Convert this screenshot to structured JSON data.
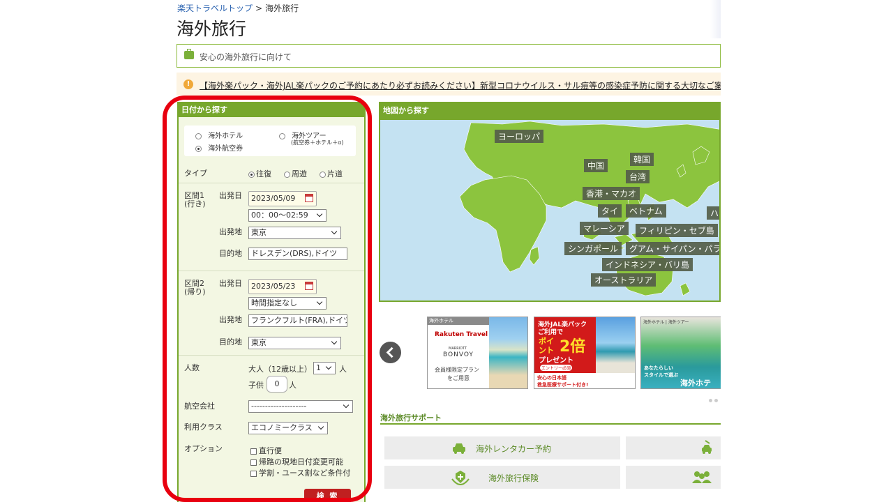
{
  "breadcrumb": {
    "home": "楽天トラベルトップ",
    "sep": ">",
    "current": "海外旅行"
  },
  "page_title": "海外旅行",
  "safety_banner": "安心の海外旅行に向けて",
  "notice": "【海外楽パック・海外JAL楽パックのご予約にあたり必ずお読みください】新型コロナウイルス・サル痘等の感染症予防に関する大切なご案内",
  "date_search": {
    "header": "日付から探す",
    "product_types": {
      "hotel": "海外ホテル",
      "tour": "海外ツアー",
      "tour_sub": "(航空券＋ホテル＋α)",
      "air": "海外航空券",
      "selected": "海外航空券"
    },
    "trip_type": {
      "label": "タイプ",
      "options": [
        "往復",
        "周遊",
        "片道"
      ],
      "selected": "往復"
    },
    "leg1": {
      "label_line1": "区間1",
      "label_line2": "(行き)",
      "date_label": "出発日",
      "date": "2023/05/09",
      "time": "00：00～02:59",
      "from_label": "出発地",
      "from": "東京",
      "to_label": "目的地",
      "to": "ドレスデン(DRS),ドイツ"
    },
    "leg2": {
      "label_line1": "区間2",
      "label_line2": "(帰り)",
      "date_label": "出発日",
      "date": "2023/05/23",
      "time": "時間指定なし",
      "from_label": "出発地",
      "from": "フランクフルト(FRA),ドイツ",
      "to_label": "目的地",
      "to": "東京"
    },
    "travelers": {
      "label": "人数",
      "adult_label": "大人（12歳以上）",
      "adult_count": "1",
      "adult_unit": "人",
      "child_label": "子供",
      "child_count": "0",
      "child_unit": "人"
    },
    "airline": {
      "label": "航空会社",
      "value": "--------------------"
    },
    "cabin": {
      "label": "利用クラス",
      "value": "エコノミークラス"
    },
    "options": {
      "label": "オプション",
      "items": [
        "直行便",
        "帰路の現地日付変更可能",
        "学割・ユース割など条件付"
      ]
    },
    "search_button": "検 索"
  },
  "map_search": {
    "header": "地図から探す",
    "regions": [
      "ヨーロッパ",
      "中国",
      "韓国",
      "台湾",
      "香港・マカオ",
      "タイ",
      "ベトナム",
      "ハ",
      "マレーシア",
      "フィリピン・セブ島",
      "シンガポール",
      "グアム・サイパン・パラオ",
      "インドネシア・バリ島",
      "オーストラリア"
    ]
  },
  "banners": {
    "card1": {
      "tag": "海外ホテル",
      "brand": "Rakuten Travel",
      "partner_line1": "MARRIOTT",
      "partner_line2": "BONVOY",
      "text_line1": "会員様限定プラン",
      "text_line2": "をご用意"
    },
    "card2": {
      "line1": "海外JAL楽パック",
      "line2": "ご利用で",
      "line3": "ポイ",
      "line4": "ント",
      "big": "2倍",
      "line5": "プレゼント",
      "entry": "エントリー必須",
      "foot1": "安心の日本語",
      "foot2": "救急医療サポート付き!"
    },
    "card3": {
      "tag": "海外ホテル | 海外ツアー",
      "line1": "あなたらしい",
      "line2": "スタイルで選ぶ",
      "big": "海外ホテ"
    }
  },
  "support": {
    "title": "海外旅行サポート",
    "rental_car": "海外レンタカー予約",
    "insurance": "海外旅行保険"
  },
  "colors": {
    "accent_green": "#77a72c",
    "search_red": "#c02020",
    "highlight_red": "#e8000f"
  }
}
